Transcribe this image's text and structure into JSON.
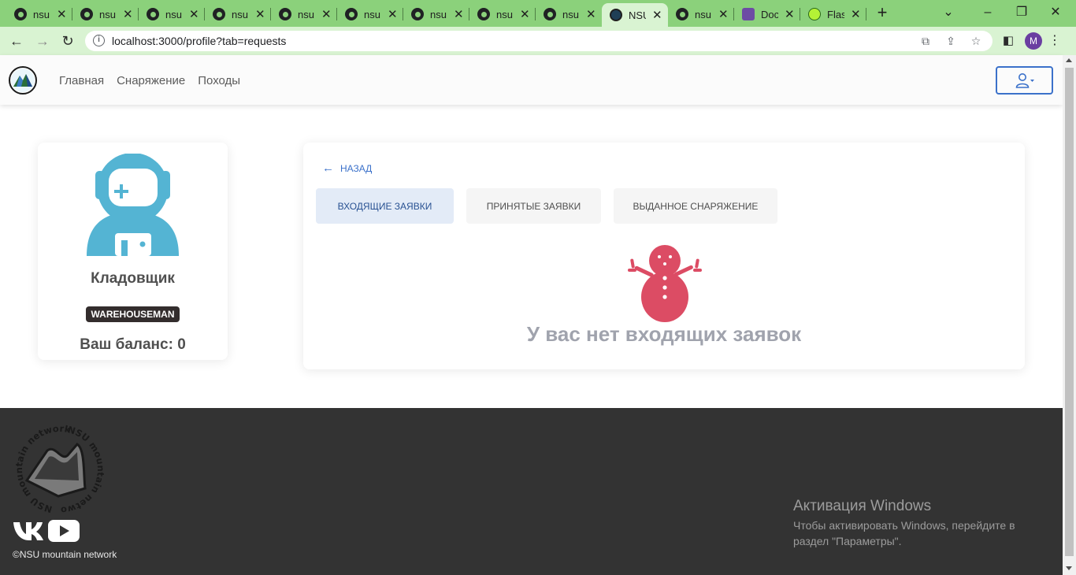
{
  "browser": {
    "tabs": [
      {
        "title": "nsu",
        "icon": "github-icon"
      },
      {
        "title": "nsu",
        "icon": "github-icon"
      },
      {
        "title": "nsu",
        "icon": "github-icon"
      },
      {
        "title": "nsu",
        "icon": "github-icon"
      },
      {
        "title": "nsu",
        "icon": "github-icon"
      },
      {
        "title": "nsu",
        "icon": "github-icon"
      },
      {
        "title": "nsu",
        "icon": "github-icon"
      },
      {
        "title": "nsu",
        "icon": "github-icon"
      },
      {
        "title": "nsu",
        "icon": "github-icon"
      },
      {
        "title": "NSU",
        "icon": "nsu-logo-icon",
        "active": true
      },
      {
        "title": "nsu",
        "icon": "github-icon"
      },
      {
        "title": "Doc",
        "icon": "trello-icon"
      },
      {
        "title": "Flas",
        "icon": "flask-icon"
      }
    ],
    "new_tab": "+",
    "url": "localhost:3000/profile?tab=requests",
    "profile_initial": "M",
    "tab_close": "✕"
  },
  "header": {
    "nav": [
      "Главная",
      "Снаряжение",
      "Походы"
    ],
    "user_icon": "user-icon"
  },
  "profile": {
    "name": "Кладовщик",
    "role": "WAREHOUSEMAN",
    "balance": "Ваш баланс: 0"
  },
  "requests": {
    "back_label": "НАЗАД",
    "tabs": [
      "ВХОДЯЩИЕ ЗАЯВКИ",
      "ПРИНЯТЫЕ ЗАЯВКИ",
      "ВЫДАННОЕ СНАРЯЖЕНИЕ"
    ],
    "active_tab": 0,
    "empty_message": "У вас нет входящих заявок"
  },
  "footer": {
    "logo_text": "NSU mountain network",
    "copyright": "©NSU mountain network"
  },
  "windows_overlay": {
    "title": "Активация Windows",
    "line": "Чтобы активировать Windows, перейдите в раздел \"Параметры\"."
  },
  "colors": {
    "tab_strip": "#8bd17b",
    "toolbar": "#d9f3d2",
    "accent": "#3b71ca",
    "avatar_blue": "#54b4d3",
    "snowman_red": "#dc4c64",
    "footer_bg": "#333333"
  }
}
